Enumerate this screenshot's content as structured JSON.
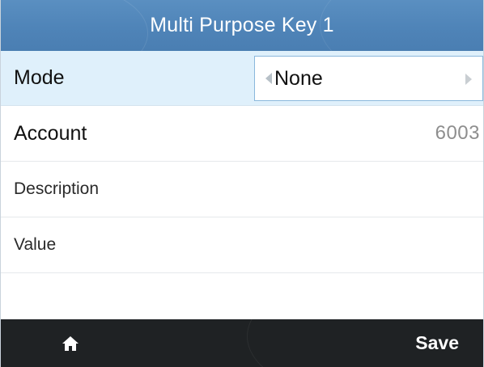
{
  "header": {
    "title": "Multi Purpose Key 1"
  },
  "fields": {
    "mode": {
      "label": "Mode",
      "value": "None"
    },
    "account": {
      "label": "Account",
      "value": "6003"
    },
    "description": {
      "label": "Description"
    },
    "value": {
      "label": "Value"
    }
  },
  "footer": {
    "home_icon": "home-icon",
    "save_label": "Save"
  },
  "colors": {
    "titlebar": "#4f84b8",
    "selected_row": "#dff0fb",
    "footer": "#1f2224"
  }
}
